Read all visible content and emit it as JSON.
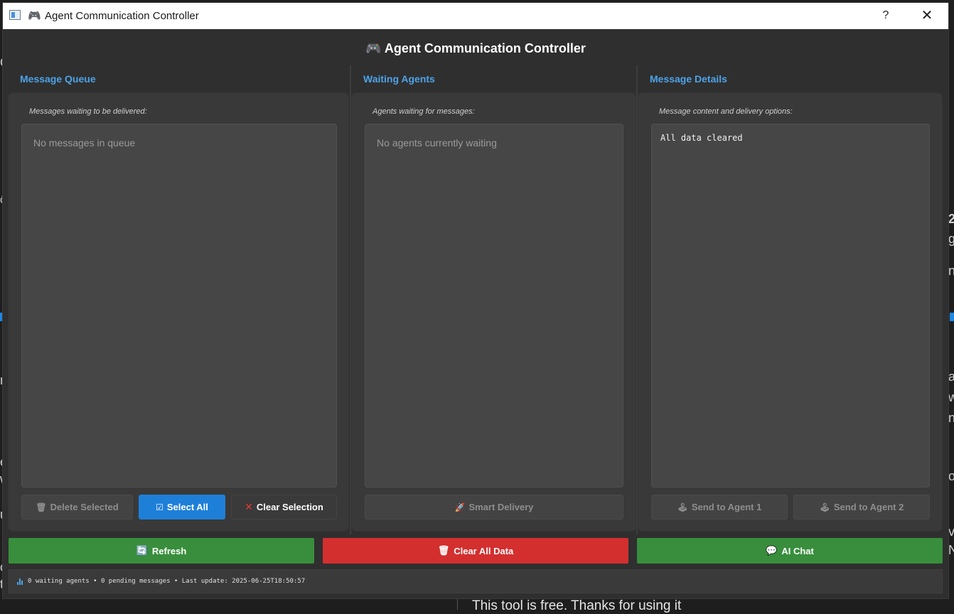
{
  "window": {
    "title": "Agent Communication Controller",
    "help_label": "?",
    "close_label": "✕"
  },
  "header": {
    "icon": "🎮",
    "title": "Agent Communication Controller"
  },
  "columns": {
    "queue": {
      "title": "Message Queue",
      "caption": "Messages waiting to be delivered:",
      "empty_text": "No messages in queue",
      "buttons": {
        "delete": "Delete Selected",
        "select_all": "Select All",
        "clear_selection": "Clear Selection"
      }
    },
    "agents": {
      "title": "Waiting Agents",
      "caption": "Agents waiting for messages:",
      "empty_text": "No agents currently waiting",
      "buttons": {
        "smart_delivery": "Smart Delivery"
      }
    },
    "details": {
      "title": "Message Details",
      "caption": "Message content and delivery options:",
      "content": "All data cleared",
      "buttons": {
        "send_agent_1": "Send to Agent 1",
        "send_agent_2": "Send to Agent 2"
      }
    }
  },
  "actions": {
    "refresh": "Refresh",
    "clear_all": "Clear All Data",
    "ai_chat": "AI Chat"
  },
  "status": {
    "text": "0 waiting agents • 0 pending messages • Last update: 2025-06-25T18:50:57"
  },
  "background": {
    "footer_text": "This tool is free. Thanks for using it"
  },
  "colors": {
    "accent_blue": "#4da3e8",
    "primary_button": "#1e7fd9",
    "green": "#388e3c",
    "red": "#d32f2f"
  }
}
